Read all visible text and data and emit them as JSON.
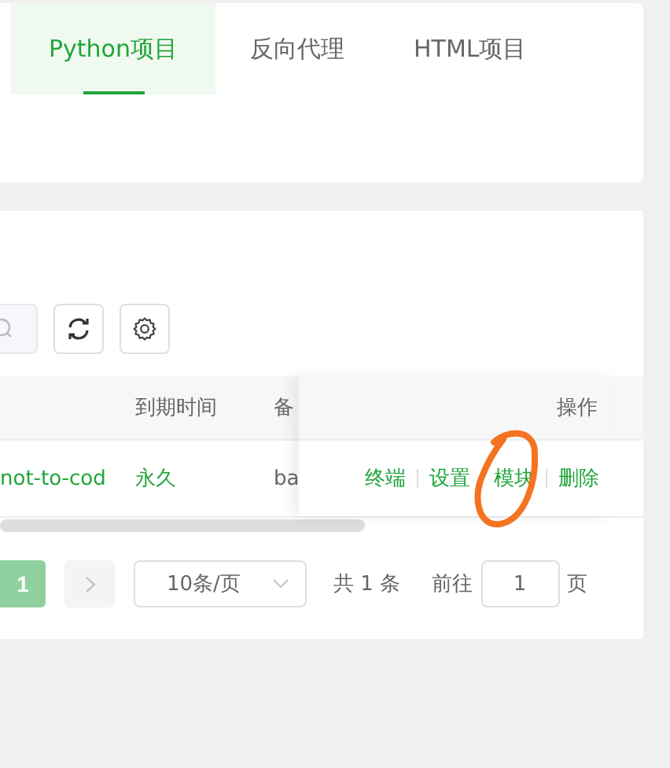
{
  "tabs": [
    {
      "label": "Python项目",
      "selected": true
    },
    {
      "label": "反向代理",
      "selected": false
    },
    {
      "label": "HTML项目",
      "selected": false
    }
  ],
  "table": {
    "columns": [
      "到期时间",
      "备"
    ],
    "action_column": "操作",
    "rows": [
      {
        "name": "not-to-cod",
        "expiry": "永久",
        "note": "ba",
        "actions": [
          "终端",
          "设置",
          "模块",
          "删除"
        ]
      }
    ]
  },
  "pagination": {
    "pages": [
      {
        "label": "1",
        "selected": true
      }
    ],
    "next_disabled": true,
    "page_size": "10条/页",
    "total": "共 1 条",
    "goto_label": "前往",
    "goto_value": "1",
    "unit": "页"
  },
  "markup": [
    {
      "kind": "circle"
    }
  ]
}
